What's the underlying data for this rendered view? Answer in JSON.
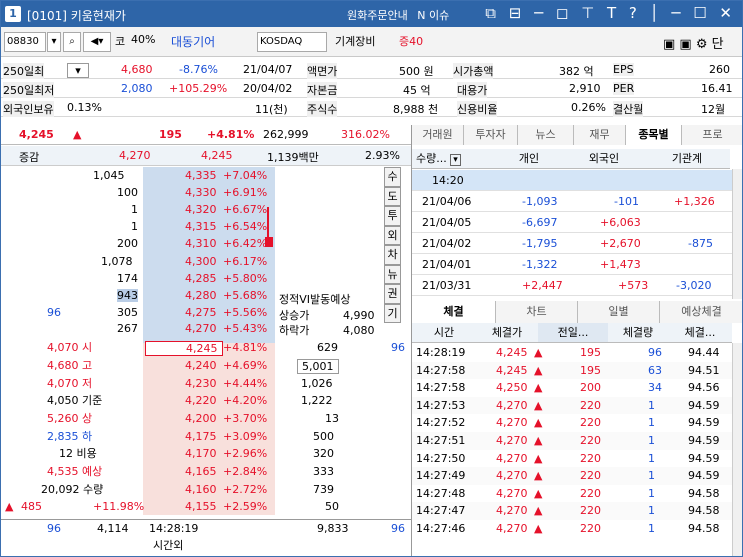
{
  "titlebar": {
    "number": "1",
    "title": "[0101] 키움현재가",
    "links": [
      "원화주문안내",
      "N 이슈"
    ],
    "icons": "⧉ ⊟ ─ ◻ ⊤ T ? │ ─ ☐ ✕"
  },
  "toolbar": {
    "code": "08830",
    "search_icon": "⌕",
    "market_prefix": "코",
    "ratio": "40%",
    "stock_name": "대동기어",
    "exchange": "KOSDAQ",
    "sector": "기계장비",
    "margin": "증40",
    "right_icons": "▣ ▣ ⚙ 단"
  },
  "info": {
    "row1": {
      "label1": "250일최",
      "val1": "4,680",
      "pct1": "-8.76%",
      "date1": "21/04/07",
      "label2": "액면가",
      "val2": "500 원",
      "label3": "시가총액",
      "val3": "382 억",
      "label4": "EPS",
      "val4": "260"
    },
    "row2": {
      "label1": "250일최저",
      "val1": "2,080",
      "pct1": "+105.29%",
      "date1": "20/04/02",
      "label2": "자본금",
      "val2": "45 억",
      "label3": "대용가",
      "val3": "2,910",
      "label4": "PER",
      "val4": "16.41"
    },
    "row3": {
      "label1": "외국인보유",
      "val1": "0.13%",
      "val1b": "11(천)",
      "label2": "주식수",
      "val2": "8,988 천",
      "label3": "신용비율",
      "val3": "0.26%",
      "label4": "결산월",
      "val4": "12월"
    }
  },
  "summary": {
    "price": "4,245",
    "arrow": "▲",
    "change": "195",
    "pct": "+4.81%",
    "volume": "262,999",
    "vol_ratio": "316.02%"
  },
  "header": {
    "label": "증감",
    "ask": "4,270",
    "bid": "4,245",
    "amount": "1,139백만",
    "pct": "2.93%"
  },
  "asks": [
    {
      "qty": "1,045",
      "price": "4,335",
      "pct": "+7.04%"
    },
    {
      "qty": "100",
      "price": "4,330",
      "pct": "+6.91%"
    },
    {
      "qty": "1",
      "price": "4,320",
      "pct": "+6.67%"
    },
    {
      "qty": "1",
      "price": "4,315",
      "pct": "+6.54%"
    },
    {
      "qty": "200",
      "price": "4,310",
      "pct": "+6.42%"
    },
    {
      "qty": "1,078",
      "price": "4,300",
      "pct": "+6.17%"
    },
    {
      "qty": "174",
      "price": "4,285",
      "pct": "+5.80%"
    },
    {
      "qty": "943",
      "price": "4,280",
      "pct": "+5.68%"
    },
    {
      "qty": "305",
      "price": "4,275",
      "pct": "+5.56%",
      "side": "96"
    },
    {
      "qty": "267",
      "price": "4,270",
      "pct": "+5.43%"
    }
  ],
  "bids": [
    {
      "left": "4,070 시",
      "price": "4,245",
      "pct": "+4.81%",
      "qty": "629",
      "side": "96"
    },
    {
      "left": "4,680 고",
      "price": "4,240",
      "pct": "+4.69%",
      "qty": "5,001"
    },
    {
      "left": "4,070 저",
      "price": "4,230",
      "pct": "+4.44%",
      "qty": "1,026"
    },
    {
      "left": "4,050 기준",
      "price": "4,220",
      "pct": "+4.20%",
      "qty": "1,222"
    },
    {
      "left": "5,260 상",
      "price": "4,200",
      "pct": "+3.70%",
      "qty": "13"
    },
    {
      "left": "2,835 하",
      "price": "4,175",
      "pct": "+3.09%",
      "qty": "500"
    },
    {
      "left": "12 비용",
      "price": "4,170",
      "pct": "+2.96%",
      "qty": "320"
    },
    {
      "left": "4,535 예상",
      "price": "4,165",
      "pct": "+2.84%",
      "qty": "333"
    },
    {
      "left": "20,092 수량",
      "price": "4,160",
      "pct": "+2.72%",
      "qty": "739"
    },
    {
      "left": "485",
      "left2": "+11.98%",
      "price": "4,155",
      "pct": "+2.59%",
      "qty": "50"
    }
  ],
  "vi_info": {
    "title": "정적VI발동예상",
    "up_label": "상승가",
    "up_val": "4,990",
    "down_label": "하락가",
    "down_val": "4,080"
  },
  "vbuttons": [
    "수",
    "도",
    "투",
    "외",
    "차",
    "뉴",
    "권",
    "기"
  ],
  "footer": {
    "left": "96",
    "sum": "4,114",
    "time": "14:28:19",
    "total": "9,833",
    "right": "96",
    "label": "시간외"
  },
  "right_tabs": [
    "거래원",
    "투자자",
    "뉴스",
    "재무",
    "종목별",
    "프로"
  ],
  "member_table": {
    "headers": [
      "수량...",
      "개인",
      "외국인",
      "기관계"
    ],
    "rows": [
      {
        "date": "14:20",
        "ind": "",
        "for": "",
        "inst": ""
      },
      {
        "date": "21/04/06",
        "ind": "-1,093",
        "for": "-101",
        "inst": "+1,326"
      },
      {
        "date": "21/04/05",
        "ind": "-6,697",
        "for": "+6,063",
        "inst": ""
      },
      {
        "date": "21/04/02",
        "ind": "-1,795",
        "for": "+2,670",
        "inst": "-875"
      },
      {
        "date": "21/04/01",
        "ind": "-1,322",
        "for": "+1,473",
        "inst": ""
      },
      {
        "date": "21/03/31",
        "ind": "+2,447",
        "for": "+573",
        "inst": "-3,020"
      }
    ]
  },
  "bottom_tabs": [
    "체결",
    "차트",
    "일별",
    "예상체결"
  ],
  "trade_table": {
    "headers": [
      "시간",
      "체결가",
      "전일...",
      "체결량",
      "체결..."
    ],
    "rows": [
      {
        "time": "14:28:19",
        "price": "4,245",
        "chg": "195",
        "qty": "96",
        "str": "94.44"
      },
      {
        "time": "14:27:58",
        "price": "4,245",
        "chg": "195",
        "qty": "63",
        "str": "94.51"
      },
      {
        "time": "14:27:58",
        "price": "4,250",
        "chg": "200",
        "qty": "34",
        "str": "94.56"
      },
      {
        "time": "14:27:53",
        "price": "4,270",
        "chg": "220",
        "qty": "1",
        "str": "94.59"
      },
      {
        "time": "14:27:52",
        "price": "4,270",
        "chg": "220",
        "qty": "1",
        "str": "94.59"
      },
      {
        "time": "14:27:51",
        "price": "4,270",
        "chg": "220",
        "qty": "1",
        "str": "94.59"
      },
      {
        "time": "14:27:50",
        "price": "4,270",
        "chg": "220",
        "qty": "1",
        "str": "94.59"
      },
      {
        "time": "14:27:49",
        "price": "4,270",
        "chg": "220",
        "qty": "1",
        "str": "94.59"
      },
      {
        "time": "14:27:48",
        "price": "4,270",
        "chg": "220",
        "qty": "1",
        "str": "94.58"
      },
      {
        "time": "14:27:47",
        "price": "4,270",
        "chg": "220",
        "qty": "1",
        "str": "94.58"
      },
      {
        "time": "14:27:46",
        "price": "4,270",
        "chg": "220",
        "qty": "1",
        "str": "94.58"
      }
    ]
  },
  "colors": {
    "up": "#e5112a",
    "down": "#1a4fd6",
    "title": "#2e65a8"
  }
}
